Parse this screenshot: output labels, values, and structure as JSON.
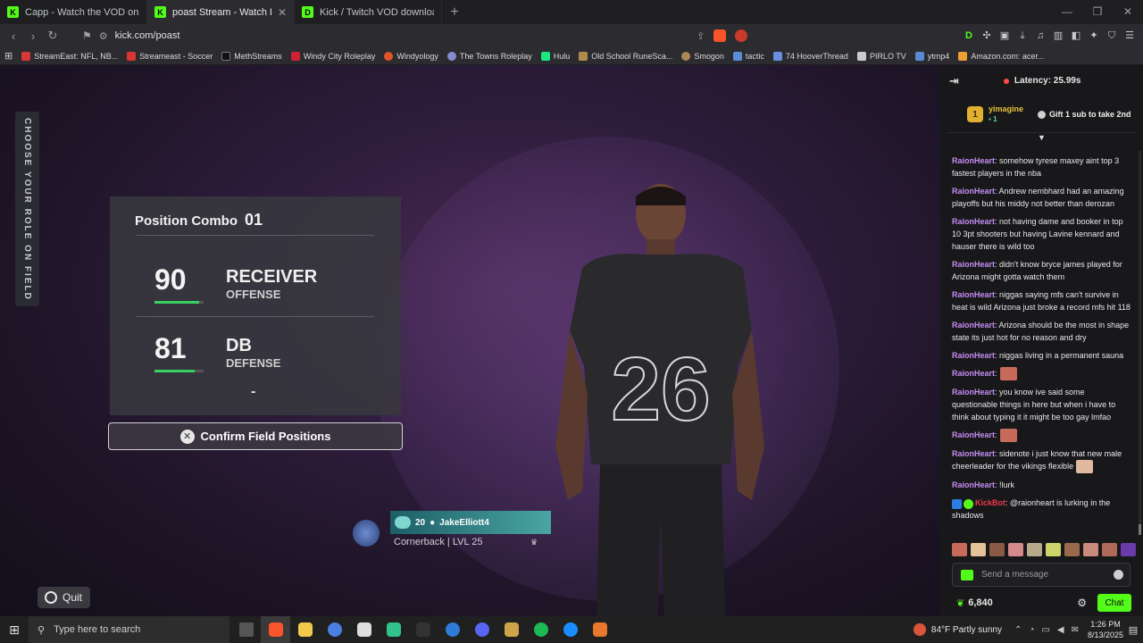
{
  "browser": {
    "tabs": [
      {
        "title": "Capp - Watch the VOD on Kick",
        "favicon": "kick-icon",
        "color": "#53fc18",
        "active": false
      },
      {
        "title": "poast Stream - Watch Live on",
        "favicon": "kick-icon",
        "color": "#53fc18",
        "active": true
      },
      {
        "title": "Kick / Twitch VOD downloader",
        "favicon": "d-icon",
        "color": "#53fc18",
        "active": false
      }
    ],
    "url": "kick.com/poast",
    "bookmarks": [
      {
        "label": "StreamEast: NFL, NB...",
        "color": "#d93636"
      },
      {
        "label": "Streameast - Soccer",
        "color": "#d93636"
      },
      {
        "label": "MethStreams",
        "color": "#111111"
      },
      {
        "label": "Windy City Roleplay",
        "color": "#c23"
      },
      {
        "label": "Windyology",
        "color": "#e0542c"
      },
      {
        "label": "The Towns Roleplay",
        "color": "#8a8ad0"
      },
      {
        "label": "Hulu",
        "color": "#1ce783"
      },
      {
        "label": "Old School RuneSca...",
        "color": "#b08a4a"
      },
      {
        "label": "Smogon",
        "color": "#a85"
      },
      {
        "label": "tactic",
        "color": "#5a8dd6"
      },
      {
        "label": "74 HooverThread",
        "color": "#6a8fe0"
      },
      {
        "label": "PIRLO TV",
        "color": "#cccccc"
      },
      {
        "label": "ytmp4",
        "color": "#5a8ad6"
      },
      {
        "label": "Amazon.com: acer...",
        "color": "#f0a030"
      }
    ]
  },
  "game": {
    "side_tab": "CHOOSE YOUR ROLE ON FIELD",
    "combo_title": "Position Combo",
    "combo_number": "01",
    "positions": [
      {
        "rating": "90",
        "name": "RECEIVER",
        "side": "OFFENSE",
        "fill": 0.9
      },
      {
        "rating": "81",
        "name": "DB",
        "side": "DEFENSE",
        "fill": 0.81
      }
    ],
    "dash": "-",
    "confirm_label": "Confirm Field Positions",
    "jersey_number": "26",
    "card": {
      "level_badge": "20",
      "gamertag": "JakeElliott4",
      "role": "Cornerback | LVL 25"
    },
    "quit_label": "Quit"
  },
  "chat": {
    "latency": "Latency: 25.99s",
    "pinned": {
      "rank": "1",
      "user": "yimagine",
      "sub_count": "1",
      "gift_text": "Gift 1 sub to take 2nd"
    },
    "messages": [
      {
        "user": "RaionHeart",
        "text": ": somehow tyrese maxey aint top 3 fastest players in the nba"
      },
      {
        "user": "RaionHeart",
        "text": ": Andrew nembhard had an amazing playoffs but his middy not better than derozan"
      },
      {
        "user": "RaionHeart",
        "text": ": not having dame and booker in top 10 3pt shooters but having Lavine kennard and hauser there is wild too"
      },
      {
        "user": "RaionHeart",
        "text": ": didn't know bryce james played for Arizona might gotta watch them"
      },
      {
        "user": "RaionHeart",
        "text": ": niggas saying mfs can't survive in heat is wild Arizona just broke a record mfs hit 118"
      },
      {
        "user": "RaionHeart",
        "text": ": Arizona should be the most in shape state its just hot for no reason and dry"
      },
      {
        "user": "RaionHeart",
        "text": ": niggas living in a permanent sauna"
      },
      {
        "user": "RaionHeart",
        "text": ":",
        "emote": true
      },
      {
        "user": "RaionHeart",
        "text": ": you know ive said some questionable things in here but when i have to think about typing it it might be too gay lmfao"
      },
      {
        "user": "RaionHeart",
        "text": ":",
        "emote": true
      },
      {
        "user": "RaionHeart",
        "text": ": sidenote i just know that new male cheerleader for the vikings flexible",
        "emote": true
      },
      {
        "user": "RaionHeart",
        "text": ": !lurk"
      },
      {
        "user": "KickBot",
        "text": ": @raionheart is lurking in the shadows",
        "bot": true
      }
    ],
    "send_placeholder": "Send a message",
    "points": "6,840",
    "chat_button": "Chat"
  },
  "taskbar": {
    "search_placeholder": "Type here to search",
    "weather": "84°F  Partly sunny",
    "time": "1:26 PM",
    "date": "8/13/2025"
  }
}
